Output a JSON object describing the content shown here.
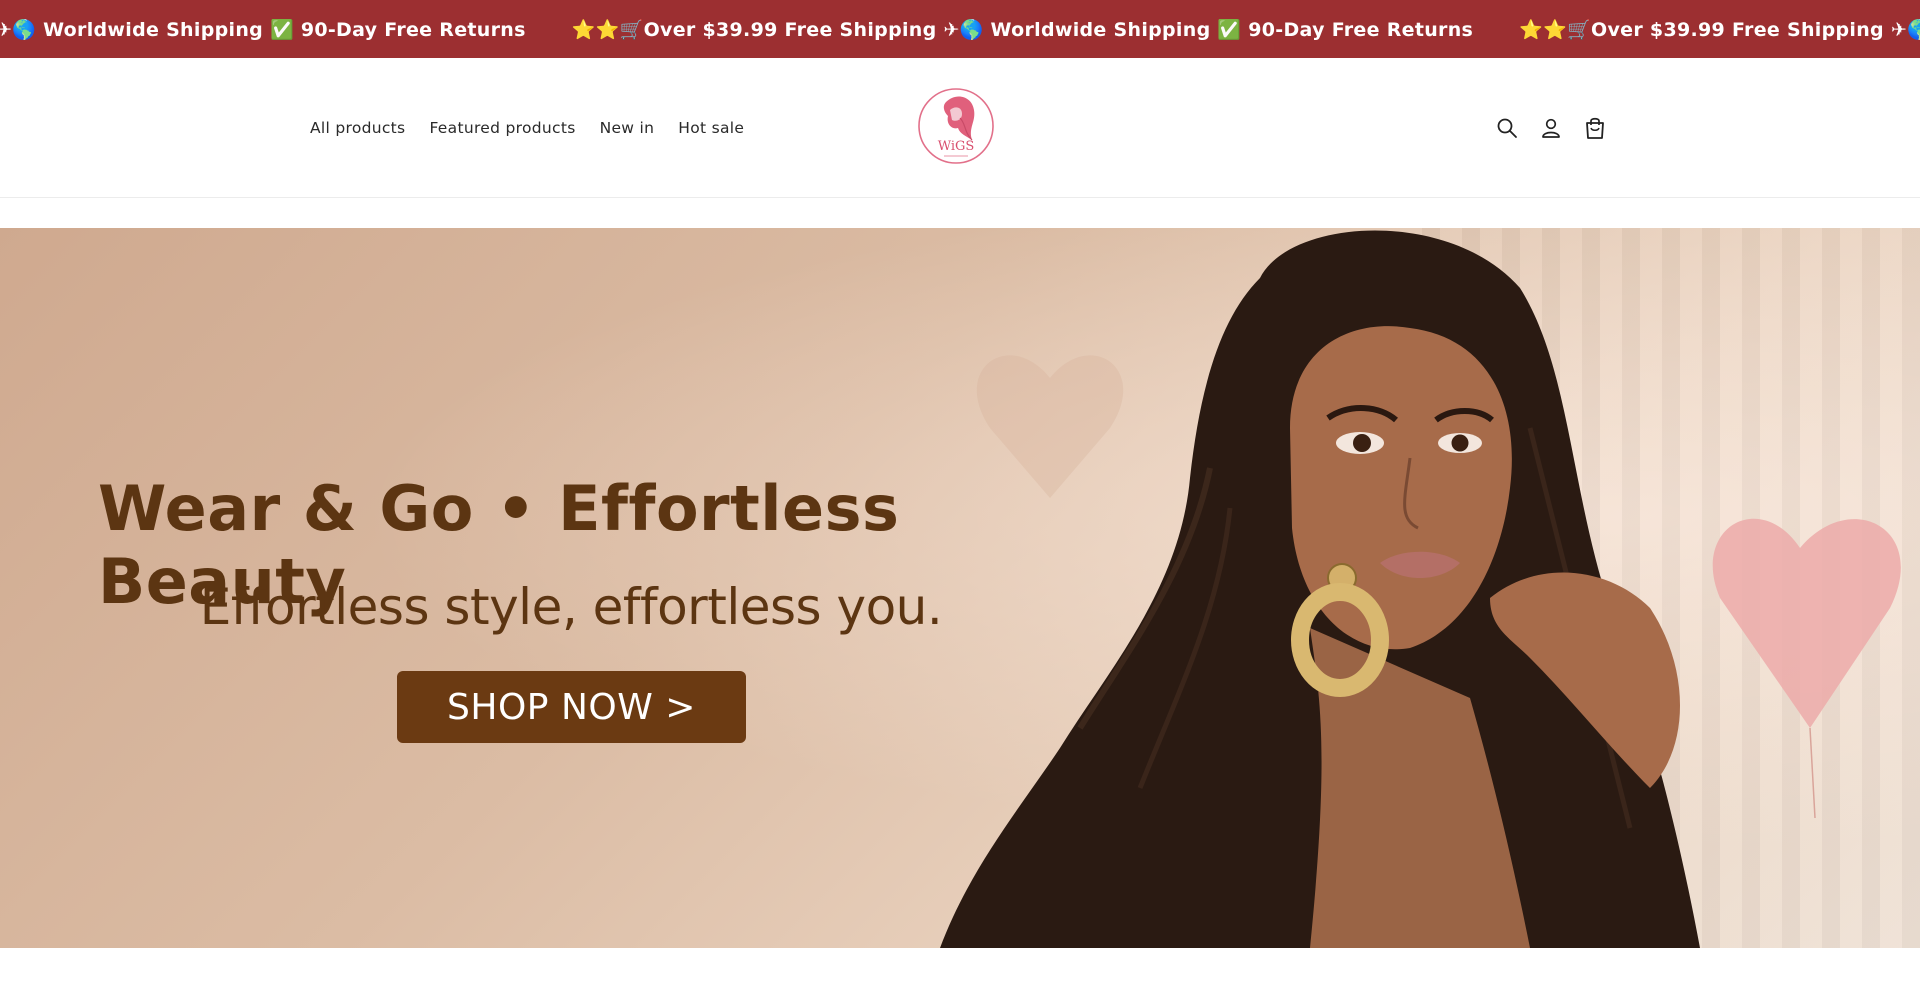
{
  "announcement": {
    "items": [
      "✈🌎 Worldwide Shipping ✅ 90-Day Free Returns",
      "⭐⭐🛒Over $39.99 Free Shipping ✈🌎 Worldwide Shipping ✅ 90-Day Free Returns",
      "⭐⭐🛒Over $39.99 Free Shipping ✈🌎 Worldwide Shipping ✅ 90-Day Free Returns"
    ],
    "bg_color": "#9c2f31"
  },
  "header": {
    "nav": [
      "All products",
      "Featured products",
      "New in",
      "Hot sale"
    ],
    "logo_text": "WiGS",
    "icons": [
      "search-icon",
      "account-icon",
      "cart-icon"
    ]
  },
  "hero": {
    "title": "Wear & Go • Effortless Beauty",
    "subtitle": "Effortless style, effortless you.",
    "cta_label": "SHOP NOW >",
    "text_color": "#5c3512",
    "button_color": "#6b3a12"
  }
}
